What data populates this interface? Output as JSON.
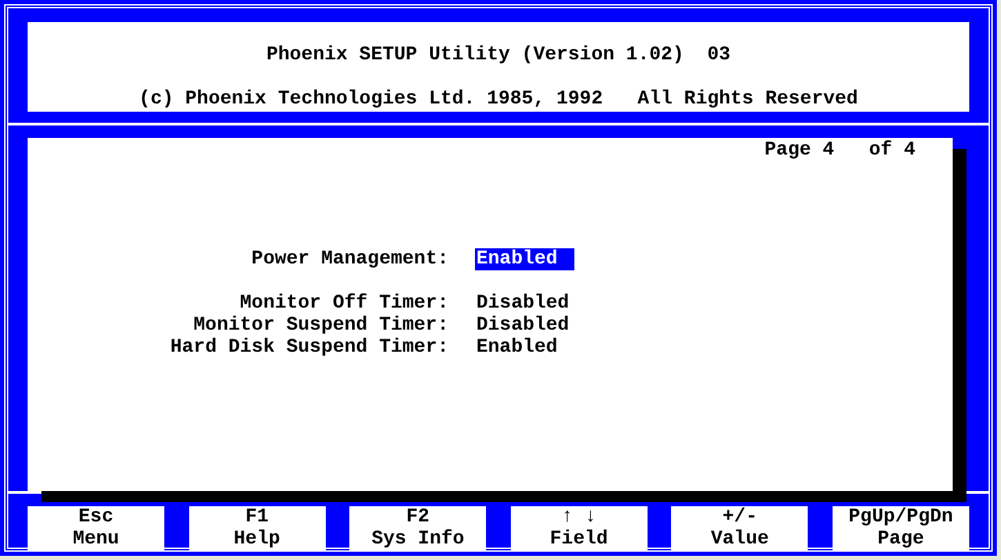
{
  "header": {
    "title": "Phoenix SETUP Utility (Version 1.02)  03",
    "copyright": "(c) Phoenix Technologies Ltd. 1985, 1992   All Rights Reserved"
  },
  "page_indicator": "Page 4   of 4",
  "sections": [
    [
      {
        "label": "Power Management:",
        "value": "Enabled",
        "selected": true
      }
    ],
    [
      {
        "label": "Monitor Off Timer:",
        "value": "Disabled",
        "selected": false
      },
      {
        "label": "Monitor Suspend Timer:",
        "value": "Disabled",
        "selected": false
      },
      {
        "label": "Hard Disk Suspend Timer:",
        "value": "Enabled",
        "selected": false
      }
    ]
  ],
  "keys": [
    {
      "key": "Esc",
      "action": "Menu"
    },
    {
      "key": "F1",
      "action": "Help"
    },
    {
      "key": "F2",
      "action": "Sys Info"
    },
    {
      "key": "↑ ↓",
      "action": "Field"
    },
    {
      "key": "+/-",
      "action": "Value"
    },
    {
      "key": "PgUp/PgDn",
      "action": "Page"
    }
  ]
}
